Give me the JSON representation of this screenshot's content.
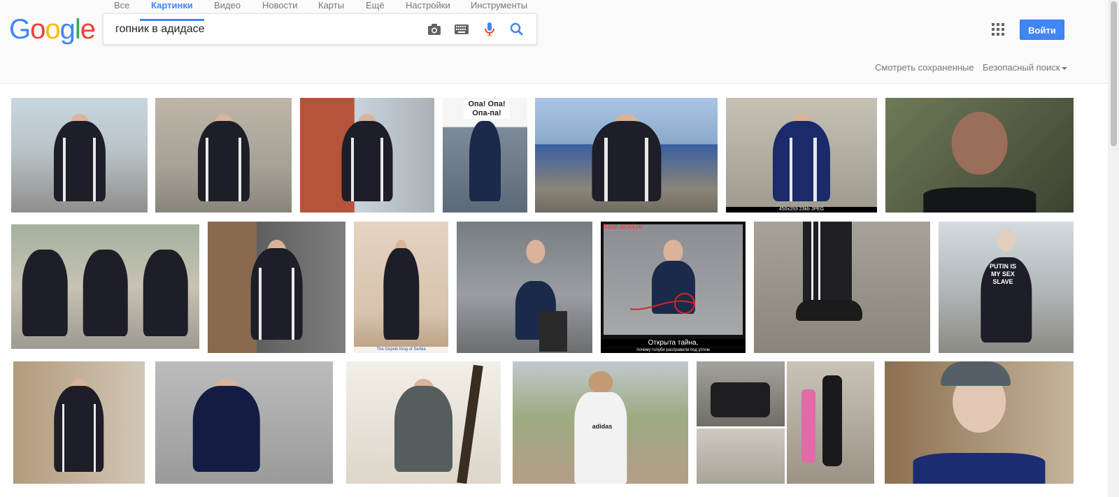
{
  "logo": {
    "letters": [
      {
        "ch": "G",
        "color": "#4285f4"
      },
      {
        "ch": "o",
        "color": "#ea4335"
      },
      {
        "ch": "o",
        "color": "#fbbc05"
      },
      {
        "ch": "g",
        "color": "#4285f4"
      },
      {
        "ch": "l",
        "color": "#34a853"
      },
      {
        "ch": "e",
        "color": "#ea4335"
      }
    ]
  },
  "search": {
    "value": "гопник в адидасе",
    "placeholder": ""
  },
  "signin_label": "Войти",
  "tabs": [
    {
      "label": "Все"
    },
    {
      "label": "Картинки"
    },
    {
      "label": "Видео"
    },
    {
      "label": "Новости"
    },
    {
      "label": "Карты"
    },
    {
      "label": "Ещё"
    },
    {
      "label": "Настройки"
    },
    {
      "label": "Инструменты"
    }
  ],
  "saved_label": "Смотреть сохраненные",
  "safesearch_label": "Безопасный поиск",
  "image_texts": {
    "opa": "Опа! Опа! Опа-па!",
    "size_info": "450x293 23kb JPEG",
    "tshirt": "PUTIN IS MY SEX SLAVE",
    "secret": "Открыта тайна,",
    "secret_sub": "почему голуби расправили под углом",
    "watermark": "bash.dc33.ru",
    "caption_small": "The Gopnik King of Serbia",
    "adidas": "adidas"
  },
  "colors": {
    "accent": "#4285f4",
    "tab_text": "#777777"
  }
}
